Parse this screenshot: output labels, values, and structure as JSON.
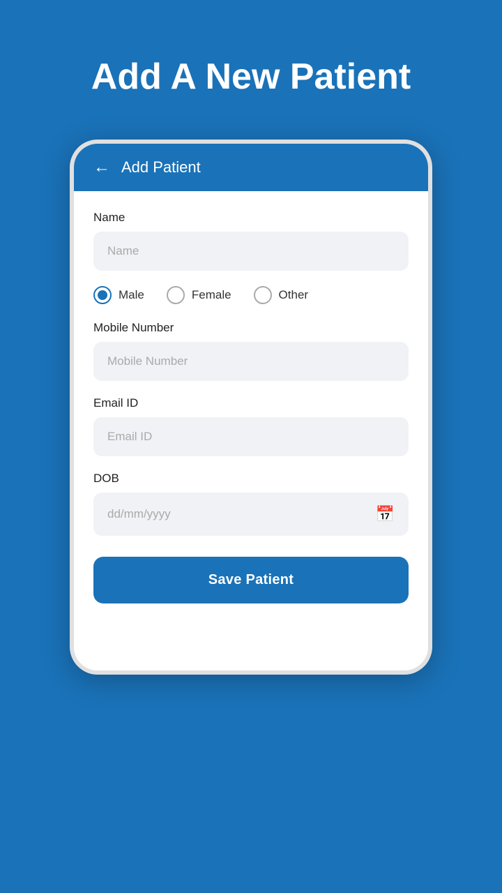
{
  "page": {
    "title": "Add A New Patient",
    "background_color": "#1a72b8"
  },
  "header": {
    "back_label": "←",
    "title": "Add Patient"
  },
  "form": {
    "name_label": "Name",
    "name_placeholder": "Name",
    "gender": {
      "options": [
        {
          "id": "male",
          "label": "Male",
          "selected": true
        },
        {
          "id": "female",
          "label": "Female",
          "selected": false
        },
        {
          "id": "other",
          "label": "Other",
          "selected": false
        }
      ]
    },
    "mobile_label": "Mobile Number",
    "mobile_placeholder": "Mobile Number",
    "email_label": "Email ID",
    "email_placeholder": "Email ID",
    "dob_label": "DOB",
    "dob_placeholder": "dd/mm/yyyy",
    "save_button_label": "Save Patient"
  }
}
